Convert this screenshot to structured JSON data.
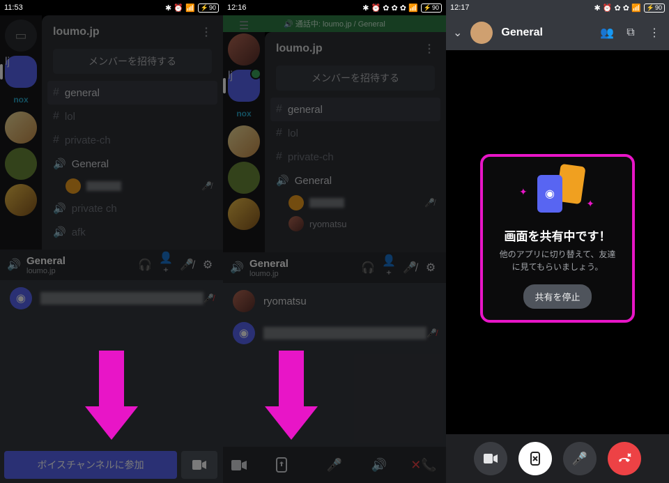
{
  "status": {
    "t1": "11:53",
    "t2": "12:16",
    "t3": "12:17",
    "battery": "90"
  },
  "server": {
    "name": "loumo.jp",
    "invite": "メンバーを招待する",
    "nox": "nox",
    "channels": {
      "general": "general",
      "lol": "lol",
      "private_ch": "private-ch",
      "voice_general": "General",
      "voice_private": "private ch",
      "voice_afk": "afk"
    }
  },
  "voice_footer": {
    "channel": "General",
    "server": "loumo.jp"
  },
  "members": {
    "ryomatsu": "ryomatsu"
  },
  "c2_topstrip": "🔊  通話中: loumo.jp / General",
  "c1": {
    "join": "ボイスチャンネルに参加"
  },
  "c3": {
    "title": "General",
    "card_title": "画面を共有中です！",
    "card_body": "他のアプリに切り替えて、友達に見てもらいましょう。",
    "stop": "共有を停止"
  }
}
